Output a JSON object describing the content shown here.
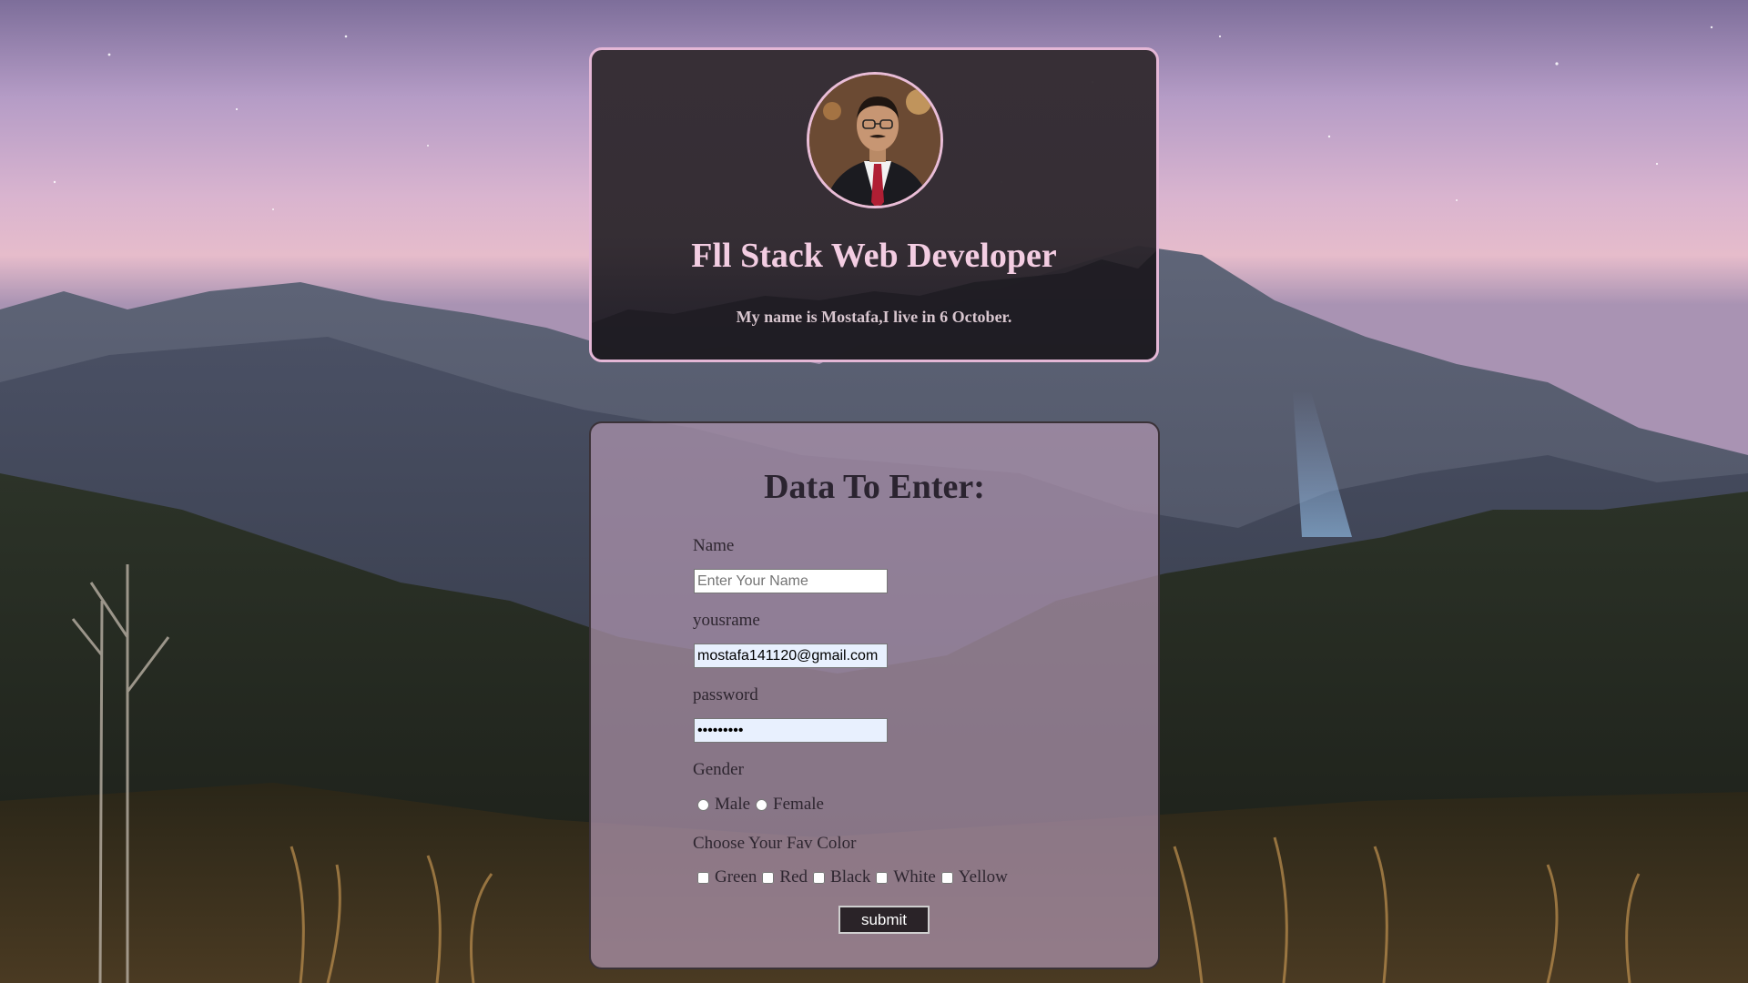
{
  "profile": {
    "title": "Fll Stack Web Developer",
    "subtitle": "My name is Mostafa,I live in 6 October."
  },
  "form": {
    "title": "Data To Enter:",
    "name_label": "Name",
    "name_placeholder": "Enter Your Name",
    "name_value": "",
    "username_label": "yousrame",
    "username_value": "mostafa141120@gmail.com",
    "password_label": "password",
    "password_value": "•••••••••",
    "gender_label": "Gender",
    "gender_options": [
      "Male",
      "Female"
    ],
    "color_label": "Choose Your Fav Color",
    "color_options": [
      "Green",
      "Red",
      "Black",
      "White",
      "Yellow"
    ],
    "submit_label": "submit"
  },
  "colors": {
    "card_border": "#e4b7d6",
    "title_pink": "#f3cde2",
    "submit_bg": "#2a2328"
  }
}
